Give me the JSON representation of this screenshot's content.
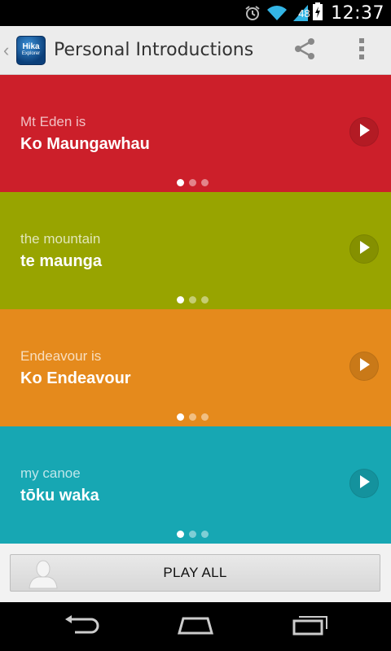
{
  "status_bar": {
    "time": "12:37",
    "battery_level": "48",
    "icons": [
      "alarm-icon",
      "wifi-icon",
      "signal-icon",
      "battery-charging-icon"
    ]
  },
  "action_bar": {
    "app_logo_text": "Hika",
    "app_logo_subtext": "Explorer",
    "title": "Personal Introductions",
    "actions": [
      "share-icon",
      "overflow-menu-icon"
    ]
  },
  "cards": [
    {
      "subtitle": "Mt Eden is",
      "phrase": "Ko Maungawhau",
      "color": "#cc1f2a",
      "active_page": 0
    },
    {
      "subtitle": "the mountain",
      "phrase": "te maunga",
      "color": "#98a400",
      "active_page": 0
    },
    {
      "subtitle": "Endeavour is",
      "phrase": "Ko Endeavour",
      "color": "#e58a1c",
      "active_page": 0
    },
    {
      "subtitle": "my canoe",
      "phrase": "tōku waka",
      "color": "#17a7b3",
      "active_page": 0
    }
  ],
  "pager_pages": 3,
  "play_all": {
    "label": "PLAY ALL"
  },
  "nav_bar": {
    "buttons": [
      "back-icon",
      "home-icon",
      "recent-apps-icon"
    ]
  }
}
